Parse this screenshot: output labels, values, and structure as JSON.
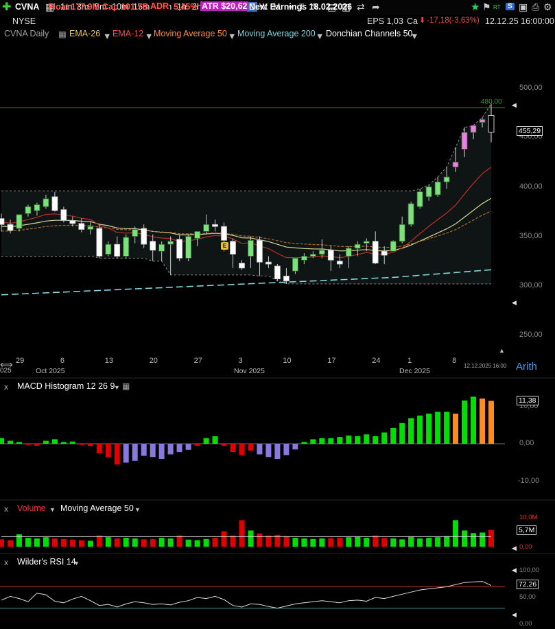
{
  "toolbar": {
    "symbol": "CVNA",
    "intervals": [
      "1m",
      "3m",
      "5m",
      "10m",
      "15m",
      "26m",
      "1h",
      "2h",
      "130m",
      "4h",
      "D",
      "W",
      "M"
    ],
    "active_interval": "D",
    "float": "Float 177.9M",
    "cap": "Cap 101.7B",
    "adr_label": "ADR",
    "adr_value": "5,45%",
    "atr": "ATR $20,62",
    "next_earnings": "Next Earnings 18.02.2026",
    "rt_label": "RT",
    "s_label": "S"
  },
  "info_row": {
    "exchange": "NYSE",
    "eps": "EPS 1,03",
    "cap_abbrev": "Ca",
    "change": "-17,18(-3,63%)",
    "datetime": "12.12.25 16:00:00"
  },
  "indicators_row": {
    "chart_label": "CVNA Daily",
    "ema26": "EMA-26",
    "ema12": "EMA-12",
    "ma50": "Moving Average 50",
    "ma200": "Moving Average 200",
    "donchian": "Donchian Channels 50"
  },
  "colors": {
    "up": "#7de07d",
    "down": "#ffffff",
    "recent_up": "#f07ce8",
    "ema12": "#c0302a",
    "ema26": "#b06a30",
    "ma50": "#d8d890",
    "ma200": "#7fd8e0",
    "donchian": "#888888",
    "macd_pos": "#00e000",
    "macd_neg": "#e00000",
    "macd_purple": "#8878e0",
    "macd_orange": "#ff8c1a",
    "rsi_line": "#e0e0e0",
    "rsi_upper": "#c03030",
    "rsi_lower": "#3fa0a0"
  },
  "price_axis": {
    "labels": [
      "500,00",
      "450,00",
      "400,00",
      "350,00",
      "300,00",
      "250,00"
    ],
    "last_price": "455,29",
    "hline_label": "480,00",
    "scale_type": "Arith"
  },
  "time_axis": {
    "ticks": [
      "29",
      "6",
      "13",
      "20",
      "27",
      "3",
      "10",
      "17",
      "24",
      "1",
      "8"
    ],
    "months": [
      "Oct 2025",
      "Nov 2025",
      "Dec 2025"
    ],
    "first_partial": "025",
    "stamp": "12.12.2025 16:00"
  },
  "earnings_marker": "E",
  "macd_panel": {
    "title": "MACD Histogram 12 26 9",
    "labels": [
      "10,00",
      "0,00",
      "-10,00"
    ],
    "last_value": "11,38"
  },
  "volume_panel": {
    "title": "Volume",
    "ma_title": "Moving Average 50",
    "labels": [
      "10,0M",
      "0,00"
    ],
    "last_value": "5,7M"
  },
  "rsi_panel": {
    "title": "Wilder's RSI 14",
    "labels": [
      "100,00",
      "50,00",
      "0,00"
    ],
    "last_value": "72,26"
  },
  "chart_data": {
    "type": "candlestick",
    "symbol": "CVNA",
    "interval": "Daily",
    "ylim": [
      250,
      500
    ],
    "dates": [
      "2025-09-25",
      "2025-09-26",
      "2025-09-29",
      "2025-09-30",
      "2025-10-01",
      "2025-10-02",
      "2025-10-03",
      "2025-10-06",
      "2025-10-07",
      "2025-10-08",
      "2025-10-09",
      "2025-10-10",
      "2025-10-13",
      "2025-10-14",
      "2025-10-15",
      "2025-10-16",
      "2025-10-17",
      "2025-10-20",
      "2025-10-21",
      "2025-10-22",
      "2025-10-23",
      "2025-10-24",
      "2025-10-27",
      "2025-10-28",
      "2025-10-29",
      "2025-10-30",
      "2025-10-31",
      "2025-11-03",
      "2025-11-04",
      "2025-11-05",
      "2025-11-06",
      "2025-11-07",
      "2025-11-10",
      "2025-11-11",
      "2025-11-12",
      "2025-11-13",
      "2025-11-14",
      "2025-11-17",
      "2025-11-18",
      "2025-11-19",
      "2025-11-20",
      "2025-11-21",
      "2025-11-24",
      "2025-11-25",
      "2025-11-26",
      "2025-11-28",
      "2025-12-01",
      "2025-12-02",
      "2025-12-03",
      "2025-12-04",
      "2025-12-05",
      "2025-12-08",
      "2025-12-09",
      "2025-12-10",
      "2025-12-11",
      "2025-12-12"
    ],
    "ohlc": [
      [
        368,
        373,
        355,
        362
      ],
      [
        362,
        367,
        353,
        356
      ],
      [
        358,
        372,
        355,
        372
      ],
      [
        373,
        382,
        370,
        380
      ],
      [
        376,
        384,
        371,
        382
      ],
      [
        380,
        392,
        378,
        388
      ],
      [
        390,
        395,
        375,
        376
      ],
      [
        377,
        380,
        364,
        366
      ],
      [
        366,
        370,
        360,
        363
      ],
      [
        363,
        368,
        354,
        357
      ],
      [
        357,
        365,
        352,
        360
      ],
      [
        358,
        362,
        328,
        330
      ],
      [
        332,
        345,
        330,
        342
      ],
      [
        342,
        350,
        328,
        330
      ],
      [
        330,
        352,
        328,
        349
      ],
      [
        350,
        360,
        343,
        357
      ],
      [
        358,
        362,
        338,
        342
      ],
      [
        345,
        352,
        325,
        336
      ],
      [
        335,
        345,
        325,
        342
      ],
      [
        342,
        350,
        311,
        345
      ],
      [
        347,
        352,
        325,
        328
      ],
      [
        328,
        352,
        325,
        350
      ],
      [
        348,
        355,
        340,
        355
      ],
      [
        355,
        372,
        352,
        362
      ],
      [
        362,
        367,
        355,
        360
      ],
      [
        360,
        364,
        335,
        346
      ],
      [
        345,
        348,
        318,
        332
      ],
      [
        323,
        326,
        316,
        318
      ],
      [
        330,
        350,
        318,
        346
      ],
      [
        346,
        350,
        310,
        324
      ],
      [
        324,
        330,
        318,
        322
      ],
      [
        320,
        322,
        305,
        307
      ],
      [
        310,
        318,
        302,
        305
      ],
      [
        315,
        328,
        312,
        328
      ],
      [
        326,
        333,
        322,
        330
      ],
      [
        330,
        335,
        328,
        332
      ],
      [
        332,
        347,
        328,
        336
      ],
      [
        336,
        341,
        315,
        326
      ],
      [
        325,
        332,
        318,
        322
      ],
      [
        330,
        340,
        318,
        338
      ],
      [
        338,
        345,
        330,
        342
      ],
      [
        343,
        348,
        335,
        345
      ],
      [
        345,
        355,
        322,
        323
      ],
      [
        335,
        340,
        322,
        331
      ],
      [
        335,
        346,
        335,
        345
      ],
      [
        345,
        370,
        343,
        362
      ],
      [
        362,
        385,
        360,
        383
      ],
      [
        380,
        398,
        378,
        395
      ],
      [
        390,
        402,
        386,
        400
      ],
      [
        392,
        410,
        390,
        405
      ],
      [
        405,
        420,
        398,
        410
      ],
      [
        420,
        440,
        415,
        425
      ],
      [
        438,
        460,
        430,
        455
      ],
      [
        455,
        462,
        448,
        462
      ],
      [
        465,
        470,
        460,
        468
      ],
      [
        472,
        484,
        445,
        455
      ]
    ],
    "resistance_line": 480,
    "last_close": 455.29,
    "macd_hist": [
      1.5,
      0.8,
      0.5,
      -0.3,
      -0.5,
      0.8,
      1.2,
      0.5,
      0.6,
      -0.3,
      -0.6,
      -2.5,
      -3.5,
      -5.5,
      -5.0,
      -4.5,
      -3.2,
      -3.5,
      -4.0,
      -2.8,
      -2.2,
      -1.6,
      -0.5,
      1.5,
      2.0,
      -0.5,
      -2.2,
      -3.0,
      -1.8,
      -2.8,
      -3.5,
      -4.0,
      -3.0,
      -1.5,
      0.5,
      1.2,
      1.5,
      1.5,
      1.8,
      2.2,
      2.0,
      2.5,
      2.0,
      3.0,
      4.2,
      5.5,
      6.8,
      7.5,
      8.0,
      8.5,
      8.5,
      8.0,
      11.5,
      12.5,
      12.0,
      11.38
    ],
    "volume_m": [
      2.5,
      2.2,
      4.2,
      3.0,
      2.8,
      3.2,
      2.8,
      2.6,
      2.4,
      2.2,
      2.0,
      3.8,
      3.2,
      2.8,
      3.0,
      2.8,
      2.5,
      2.6,
      3.0,
      2.8,
      3.8,
      2.4,
      2.2,
      2.6,
      3.0,
      5.2,
      3.8,
      9.0,
      5.5,
      4.5,
      3.8,
      4.0,
      3.6,
      3.0,
      2.8,
      2.6,
      2.8,
      2.9,
      3.0,
      3.2,
      3.5,
      3.0,
      3.8,
      3.0,
      2.8,
      2.5,
      3.5,
      2.8,
      3.0,
      3.2,
      3.6,
      9.0,
      5.5,
      4.6,
      4.8,
      5.7
    ],
    "rsi": [
      45,
      52,
      48,
      42,
      58,
      55,
      43,
      40,
      47,
      52,
      44,
      35,
      37,
      32,
      38,
      42,
      40,
      37,
      38,
      36,
      41,
      44,
      50,
      48,
      52,
      46,
      35,
      32,
      38,
      37,
      33,
      30,
      34,
      38,
      40,
      42,
      44,
      42,
      40,
      44,
      45,
      43,
      50,
      48,
      52,
      56,
      60,
      64,
      66,
      68,
      70,
      74,
      78,
      79,
      80,
      72.26
    ]
  }
}
